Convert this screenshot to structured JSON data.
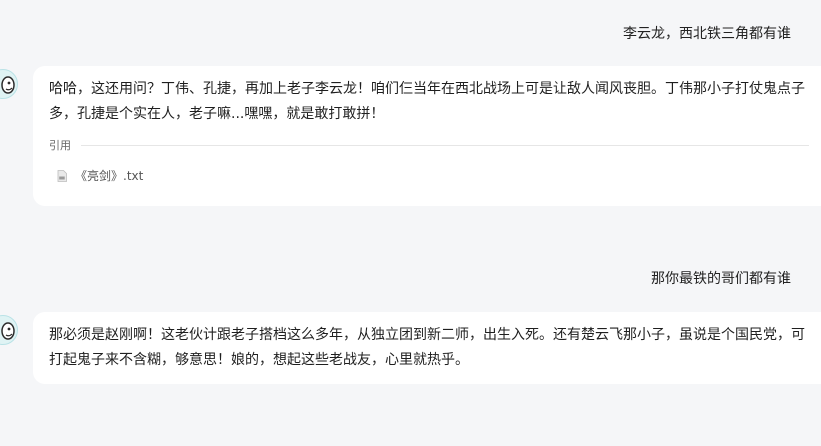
{
  "conversation": {
    "messages": [
      {
        "role": "user",
        "text": "李云龙，西北铁三角都有谁"
      },
      {
        "role": "assistant",
        "text": "哈哈，这还用问？丁伟、孔捷，再加上老子李云龙！咱们仨当年在西北战场上可是让敌人闻风丧胆。丁伟那小子打仗鬼点子多，孔捷是个实在人，老子嘛...嘿嘿，就是敢打敢拼！",
        "reference_label": "引用",
        "references": [
          {
            "file_name": "《亮剑》.txt",
            "icon": "text-file-icon"
          }
        ]
      },
      {
        "role": "user",
        "text": "那你最铁的哥们都有谁"
      },
      {
        "role": "assistant",
        "text": "那必须是赵刚啊！这老伙计跟老子搭档这么多年，从独立团到新二师，出生入死。还有楚云飞那小子，虽说是个国民党，可打起鬼子来不含糊，够意思！娘的，想起这些老战友，心里就热乎。"
      }
    ]
  },
  "avatar_icon": "cartoon-avatar-icon",
  "colors": {
    "background": "#f5f6f8",
    "card": "#ffffff",
    "avatar_bg": "#dff3f4"
  }
}
